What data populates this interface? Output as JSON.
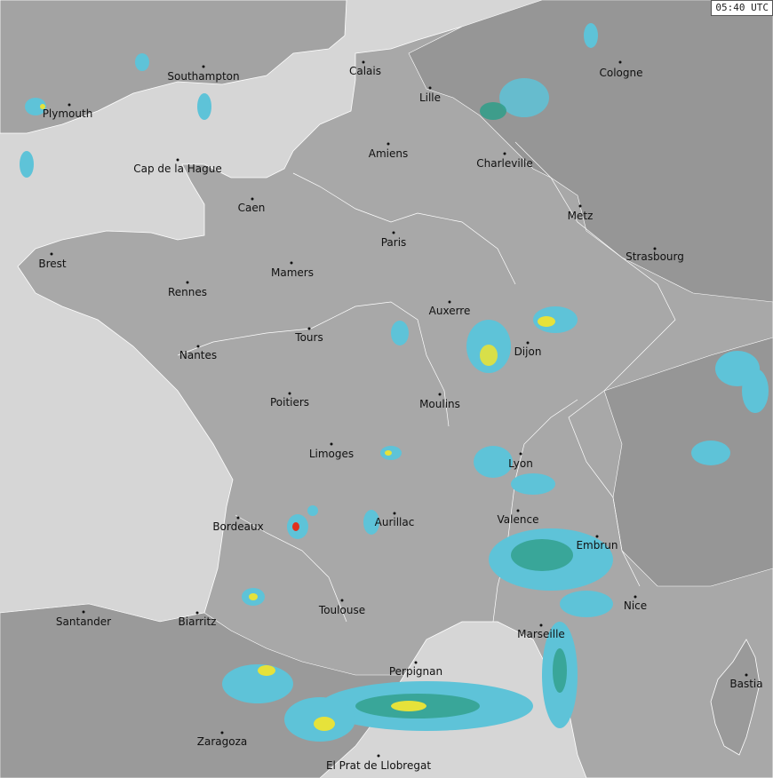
{
  "timestamp": "05:40 UTC",
  "colors": {
    "sea": "#d6d6d6",
    "land": "#a8a8a8",
    "land_dark": "#989898",
    "border": "#ffffff",
    "echo_light": "#5ec3d8",
    "echo_medium": "#2f9f8a",
    "echo_strong": "#e6e23a",
    "echo_intense": "#e0301e"
  },
  "cities": [
    {
      "name": "Southampton"
    },
    {
      "name": "Calais"
    },
    {
      "name": "Cologne"
    },
    {
      "name": "Plymouth"
    },
    {
      "name": "Lille"
    },
    {
      "name": "Amiens"
    },
    {
      "name": "Charleville"
    },
    {
      "name": "Cap de la Hague"
    },
    {
      "name": "Caen"
    },
    {
      "name": "Metz"
    },
    {
      "name": "Paris"
    },
    {
      "name": "Strasbourg"
    },
    {
      "name": "Brest"
    },
    {
      "name": "Mamers"
    },
    {
      "name": "Rennes"
    },
    {
      "name": "Auxerre"
    },
    {
      "name": "Tours"
    },
    {
      "name": "Dijon"
    },
    {
      "name": "Nantes"
    },
    {
      "name": "Poitiers"
    },
    {
      "name": "Moulins"
    },
    {
      "name": "Limoges"
    },
    {
      "name": "Lyon"
    },
    {
      "name": "Valence"
    },
    {
      "name": "Bordeaux"
    },
    {
      "name": "Aurillac"
    },
    {
      "name": "Embrun"
    },
    {
      "name": "Santander"
    },
    {
      "name": "Biarritz"
    },
    {
      "name": "Toulouse"
    },
    {
      "name": "Nice"
    },
    {
      "name": "Marseille"
    },
    {
      "name": "Perpignan"
    },
    {
      "name": "Bastia"
    },
    {
      "name": "Zaragoza"
    },
    {
      "name": "El Prat de Llobregat"
    }
  ]
}
